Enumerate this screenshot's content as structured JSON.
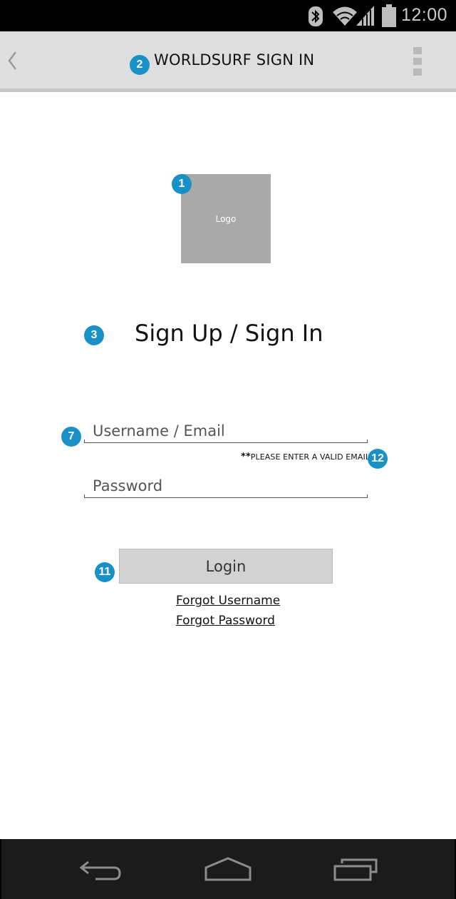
{
  "status_bar": {
    "time": "12:00",
    "icons": [
      "bluetooth-icon",
      "wifi-icon",
      "signal-icon",
      "battery-icon"
    ]
  },
  "action_bar": {
    "title": "WORLDSURF SIGN IN",
    "back_icon": "chevron-left-icon",
    "overflow_icon": "overflow-menu-icon"
  },
  "badges": {
    "logo": "1",
    "title": "2",
    "heading": "3",
    "username": "7",
    "login": "11",
    "hint": "12"
  },
  "logo": {
    "label": "Logo"
  },
  "heading": "Sign Up / Sign In",
  "form": {
    "username_placeholder": "Username / Email",
    "username_value": "",
    "hint_prefix": "**",
    "hint_text": "PLEASE ENTER A VALID EMAIL",
    "password_placeholder": "Password",
    "password_value": ""
  },
  "login_button": "Login",
  "links": {
    "forgot_username": "Forgot Username",
    "forgot_password": "Forgot Password"
  },
  "nav_bar": {
    "icons": [
      "back-icon",
      "home-icon",
      "recents-icon"
    ]
  },
  "colors": {
    "accent": "#1a91c6",
    "action_bar": "#dedede",
    "logo_placeholder": "#a9a9a9",
    "button": "#d2d2d2"
  }
}
